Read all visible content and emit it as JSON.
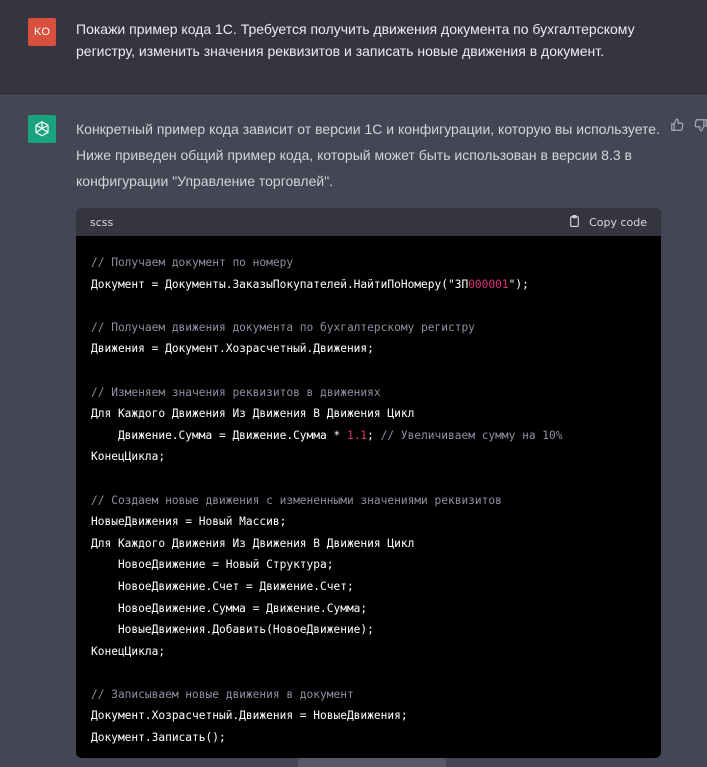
{
  "user": {
    "avatar_initials": "KO",
    "avatar_color": "#d9503f",
    "message": "Покажи пример кода 1С. Требуется получить движения документа по бухгалтерскому регистру, изменить значения реквизитов и записать новые движения  в документ."
  },
  "assistant": {
    "avatar_icon": "openai-logo-icon",
    "avatar_color": "#19a37f",
    "intro": "Конкретный пример кода зависит от версии 1С и конфигурации, которую вы используете. Ниже приведен общий пример кода, который может быть использован в версии 8.3 в конфигурации \"Управление торговлей\".",
    "feedback_icons": [
      "thumbs-up-icon",
      "thumbs-down-icon"
    ]
  },
  "code_block": {
    "language": "scss",
    "copy_label": "Copy code",
    "copy_icon": "clipboard-icon",
    "lines": [
      [
        {
          "t": "// Получаем документ по номеру",
          "c": "cmt"
        }
      ],
      [
        {
          "t": "Документ = Документы.ЗаказыПокупателей.НайтиПоНомеру(\"ЗП",
          "c": ""
        },
        {
          "t": "000001",
          "c": "num"
        },
        {
          "t": "\");",
          "c": ""
        }
      ],
      [],
      [
        {
          "t": "// Получаем движения документа по бухгалтерскому регистру",
          "c": "cmt"
        }
      ],
      [
        {
          "t": "Движения = Документ.Хозрасчетный.Движения;",
          "c": ""
        }
      ],
      [],
      [
        {
          "t": "// Изменяем значения реквизитов в движениях",
          "c": "cmt"
        }
      ],
      [
        {
          "t": "Для Каждого Движения Из Движения В Движения Цикл",
          "c": ""
        }
      ],
      [
        {
          "t": "    Движение.Сумма = Движение.Сумма * ",
          "c": ""
        },
        {
          "t": "1.1",
          "c": "num"
        },
        {
          "t": "; ",
          "c": ""
        },
        {
          "t": "// Увеличиваем сумму на 10%",
          "c": "cmt"
        }
      ],
      [
        {
          "t": "КонецЦикла;",
          "c": ""
        }
      ],
      [],
      [
        {
          "t": "// Создаем новые движения с измененными значениями реквизитов",
          "c": "cmt"
        }
      ],
      [
        {
          "t": "НовыеДвижения = Новый Массив;",
          "c": ""
        }
      ],
      [
        {
          "t": "Для Каждого Движения Из Движения В Движения Цикл",
          "c": ""
        }
      ],
      [
        {
          "t": "    НовоеДвижение = Новый Структура;",
          "c": ""
        }
      ],
      [
        {
          "t": "    НовоеДвижение.Счет = Движение.Счет;",
          "c": ""
        }
      ],
      [
        {
          "t": "    НовоеДвижение.Сумма = Движение.Сумма;",
          "c": ""
        }
      ],
      [
        {
          "t": "    НовыеДвижения.Добавить(НовоеДвижение);",
          "c": ""
        }
      ],
      [
        {
          "t": "КонецЦикла;",
          "c": ""
        }
      ],
      [],
      [
        {
          "t": "// Записываем новые движения в документ",
          "c": "cmt"
        }
      ],
      [
        {
          "t": "Документ.Хозрасчетный.Движения = НовыеДвижения;",
          "c": ""
        }
      ],
      [
        {
          "t": "Документ.Записать();",
          "c": ""
        }
      ]
    ]
  }
}
